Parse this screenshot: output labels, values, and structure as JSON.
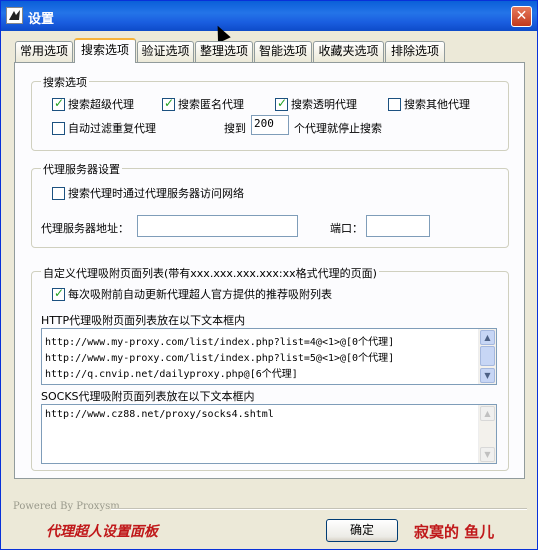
{
  "window": {
    "title": "设置",
    "close_glyph": "✕"
  },
  "tabs": [
    {
      "label": "常用选项"
    },
    {
      "label": "搜索选项"
    },
    {
      "label": "验证选项"
    },
    {
      "label": "整理选项"
    },
    {
      "label": "智能选项"
    },
    {
      "label": "收藏夹选项"
    },
    {
      "label": "排除选项"
    }
  ],
  "active_tab": "搜索选项",
  "search_options": {
    "title": "搜索选项",
    "search_super_proxy": {
      "label": "搜索超级代理",
      "checked": true
    },
    "search_anonymous_proxy": {
      "label": "搜索匿名代理",
      "checked": true
    },
    "search_transparent_proxy": {
      "label": "搜索透明代理",
      "checked": true
    },
    "search_other_proxy": {
      "label": "搜索其他代理",
      "checked": false
    },
    "auto_filter_duplicates": {
      "label": "自动过滤重复代理",
      "checked": false
    },
    "stop_prefix": "搜到",
    "stop_count": "200",
    "stop_suffix": "个代理就停止搜索"
  },
  "proxy_server": {
    "title": "代理服务器设置",
    "use_proxy": {
      "label": "搜索代理时通过代理服务器访问网络",
      "checked": false
    },
    "address_label": "代理服务器地址：",
    "address_value": "",
    "port_label": "端口：",
    "port_value": ""
  },
  "custom_pages": {
    "title": "自定义代理吸附页面列表(带有xxx.xxx.xxx.xxx:xx格式代理的页面)",
    "auto_update": {
      "label": "每次吸附前自动更新代理超人官方提供的推荐吸附列表",
      "checked": true
    },
    "http_label": "HTTP代理吸附页面列表放在以下文本框内",
    "http_lines": [
      "http://www.my-proxy.com/list/index.php?list=4@<1>@[0个代理]",
      "http://www.my-proxy.com/list/index.php?list=5@<1>@[0个代理]",
      "http://q.cnvip.net/dailyproxy.php@[6个代理]"
    ],
    "socks_label": "SOCKS代理吸附页面列表放在以下文本框内",
    "socks_lines": [
      "http://www.cz88.net/proxy/socks4.shtml"
    ]
  },
  "footer": {
    "powered_by": "Powered By Proxysm",
    "panel_name": "代理超人设置面板",
    "ok_label": "确定",
    "author": "寂寞的 鱼儿"
  },
  "scroll_glyphs": {
    "up": "▲",
    "down": "▼"
  }
}
